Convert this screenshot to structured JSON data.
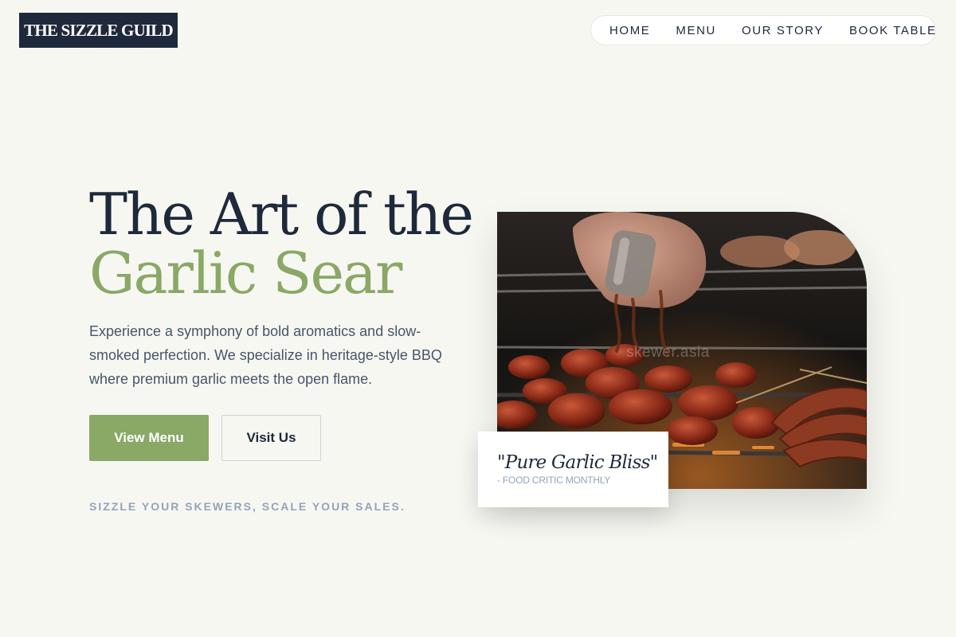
{
  "brand": {
    "logo_text": "THE SIZZLE GUILD"
  },
  "nav": {
    "items": [
      {
        "label": "HOME"
      },
      {
        "label": "MENU"
      },
      {
        "label": "OUR STORY"
      },
      {
        "label": "BOOK TABLE"
      }
    ]
  },
  "hero": {
    "headline_line1": "The Art of the",
    "headline_line2": "Garlic Sear",
    "description": "Experience a symphony of bold aromatics and slow-smoked perfection. We specialize in heritage-style BBQ where premium garlic meets the open flame.",
    "primary_cta": "View Menu",
    "secondary_cta": "Visit Us",
    "tagline": "SIZZLE YOUR SKEWERS, SCALE YOUR SALES.",
    "image_watermark": "skewer.asia",
    "image_subject": "grilled skewers and sausages being seasoned over an open flame grill"
  },
  "quote": {
    "text": "\"Pure Garlic Bliss\"",
    "source": "- FOOD CRITIC MONTHLY"
  },
  "colors": {
    "background": "#f7f7f2",
    "navy": "#1e293b",
    "accent_green": "#8aa866",
    "muted": "#94a3b8"
  }
}
